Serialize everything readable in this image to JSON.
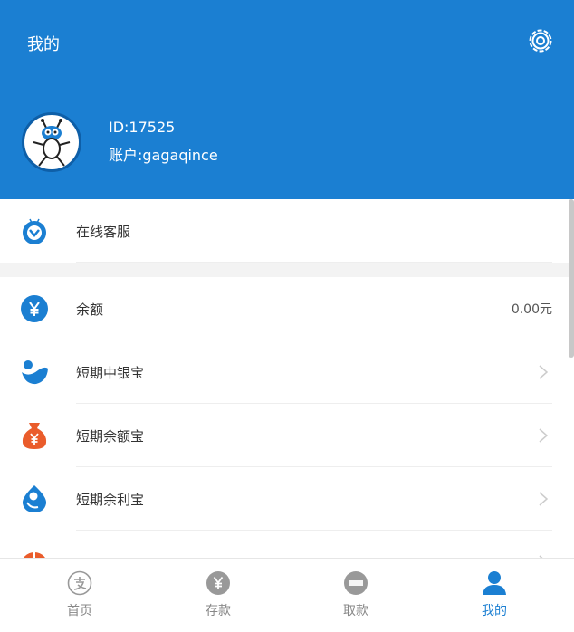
{
  "header": {
    "title": "我的",
    "settings_icon": "gear-icon",
    "background_color": "#1b7fd2"
  },
  "profile": {
    "avatar_icon": "ant-mascot-avatar",
    "id_text": "ID:17525",
    "account_text": "账户:gagaqince"
  },
  "service": {
    "icon": "customer-service-icon",
    "label": "在线客服"
  },
  "menu": [
    {
      "icon": "yuan-circle-icon",
      "label": "余额",
      "value": "0.00元"
    },
    {
      "icon": "blue-wave-icon",
      "label": "短期中银宝",
      "value": ""
    },
    {
      "icon": "money-bag-icon",
      "label": "短期余额宝",
      "value": ""
    },
    {
      "icon": "blue-drop-icon",
      "label": "短期余利宝",
      "value": ""
    }
  ],
  "tabbar": {
    "items": [
      {
        "icon": "alipay-icon",
        "label": "首页",
        "active": false
      },
      {
        "icon": "yuan-circle-icon",
        "label": "存款",
        "active": false
      },
      {
        "icon": "atm-icon",
        "label": "取款",
        "active": false
      },
      {
        "icon": "user-icon",
        "label": "我的",
        "active": true
      }
    ],
    "active_color": "#1b7fd2",
    "inactive_color": "#888888"
  }
}
